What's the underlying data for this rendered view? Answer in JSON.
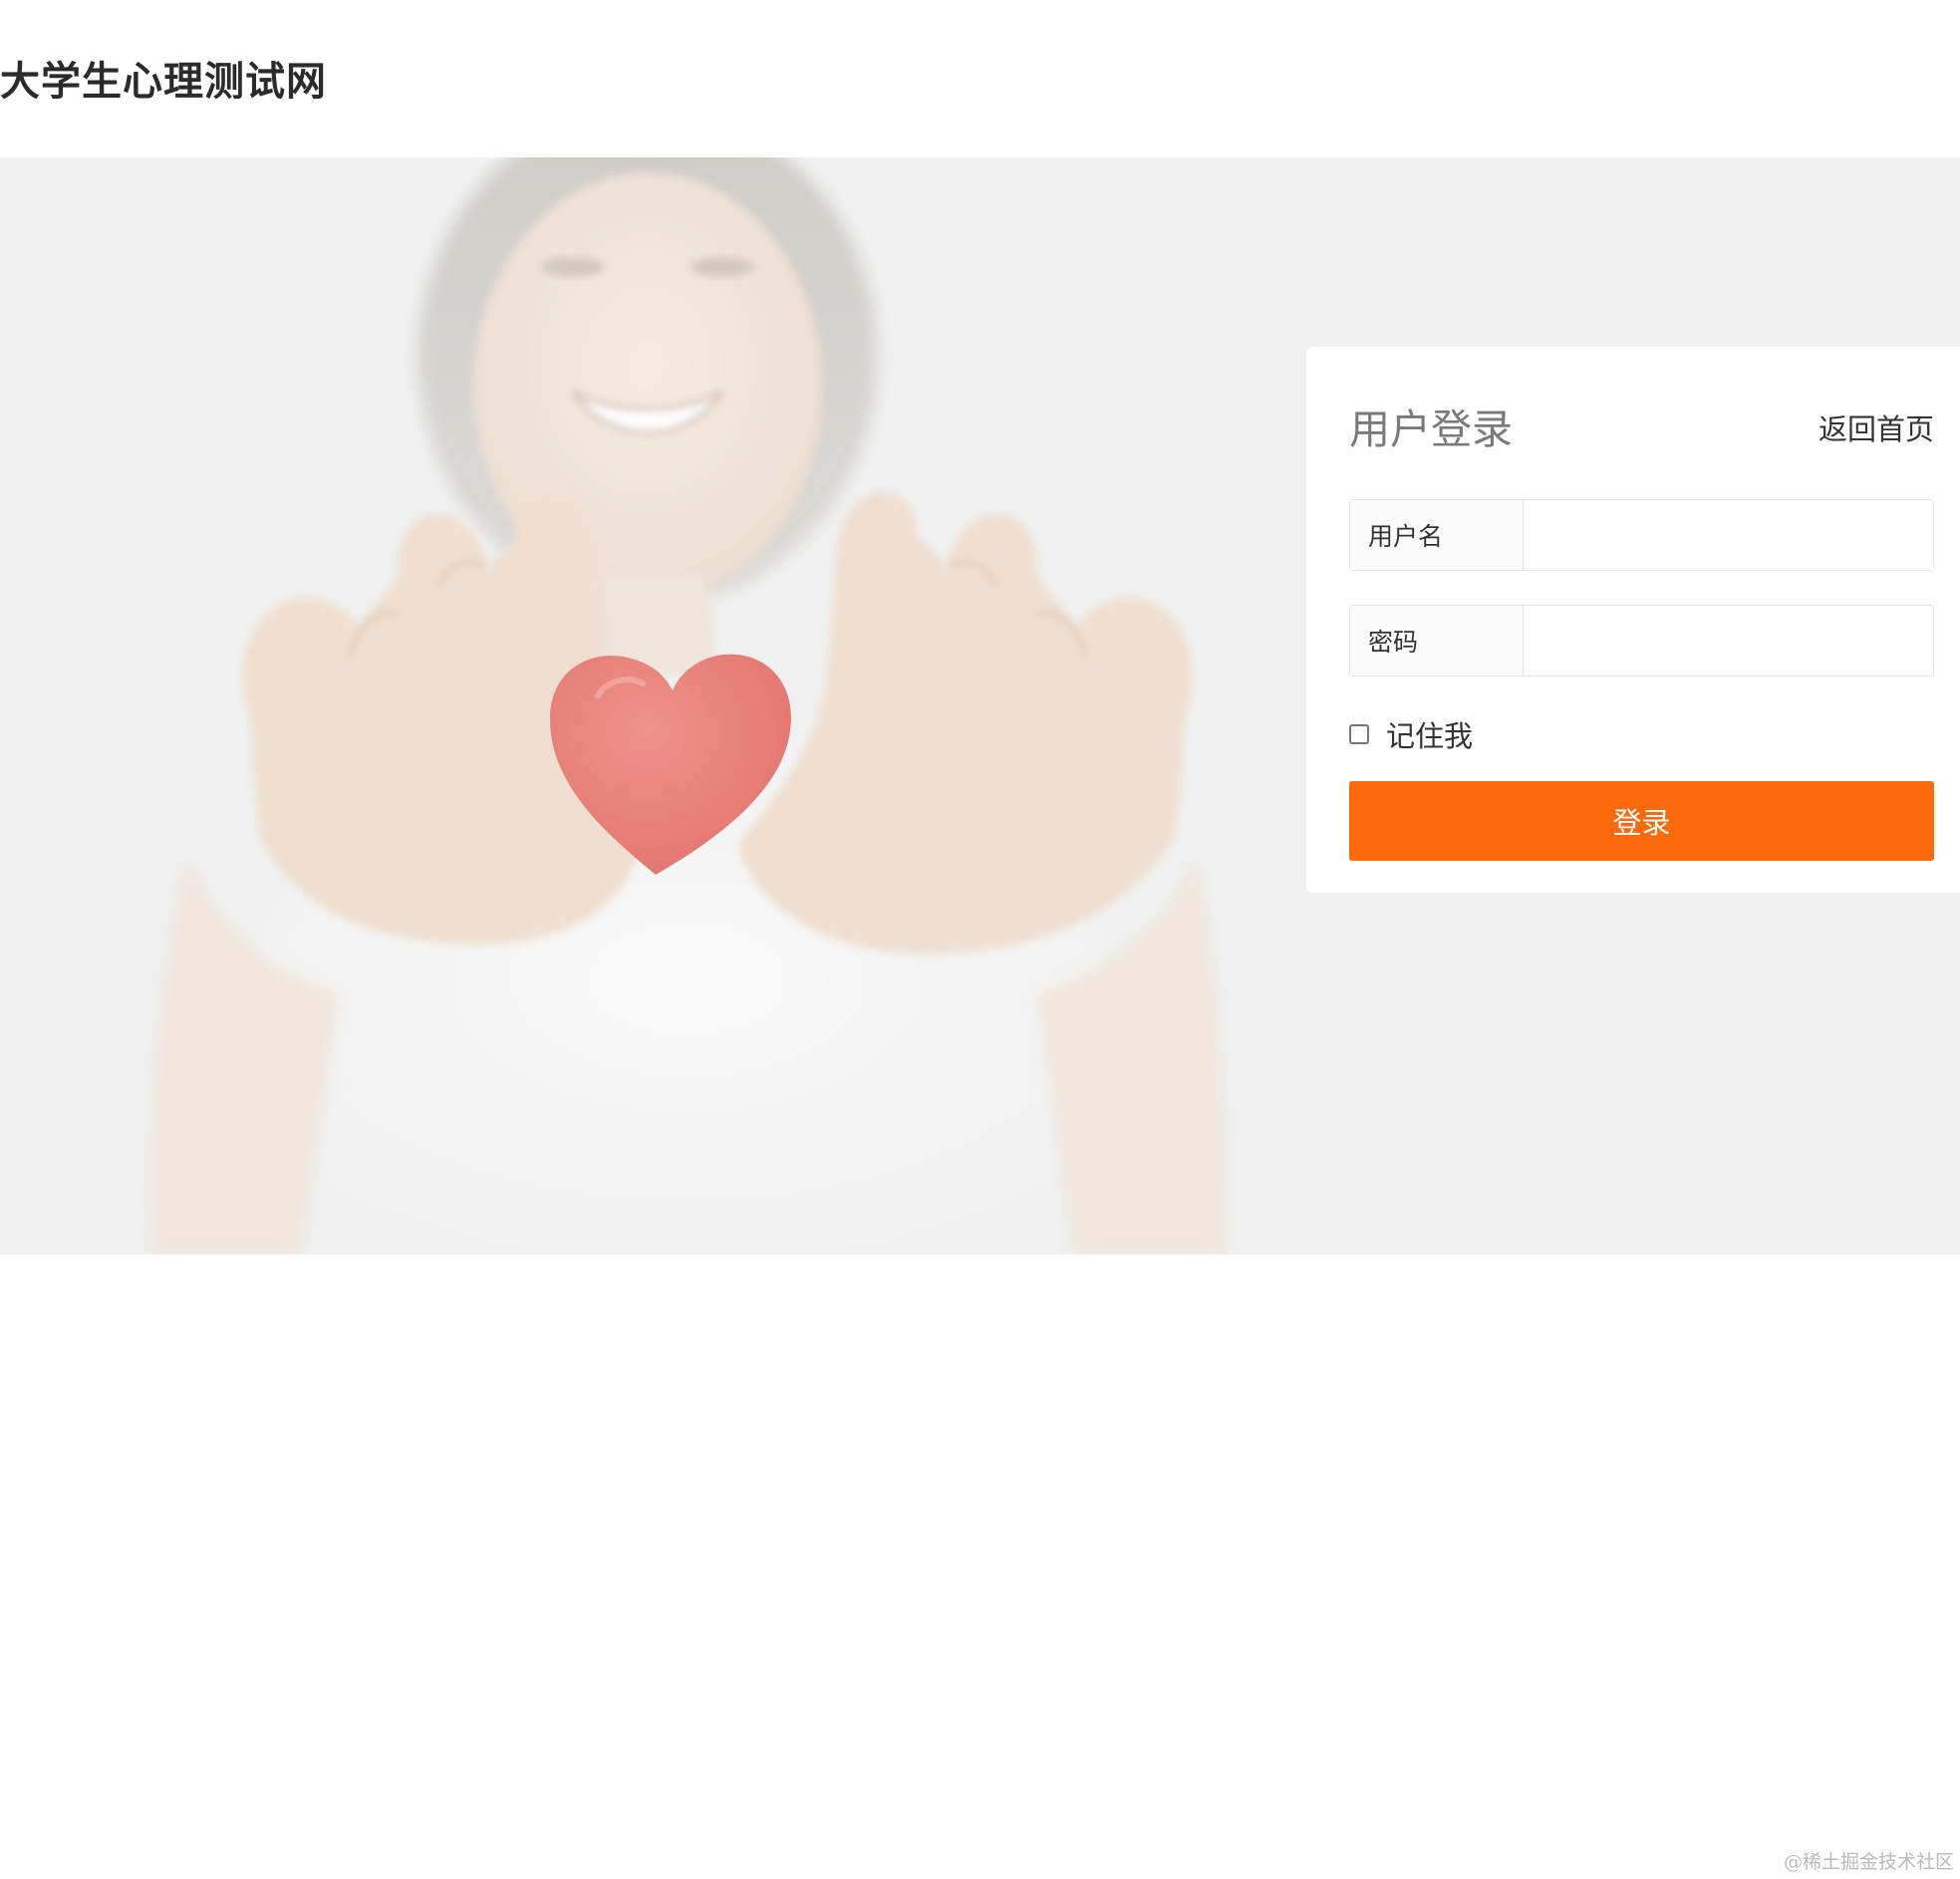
{
  "site": {
    "title": "大学生心理测试网"
  },
  "login": {
    "title": "用户登录",
    "back_link": "返回首页",
    "username_label": "用户名",
    "username_value": "",
    "password_label": "密码",
    "password_value": "",
    "remember_label": "记住我",
    "remember_checked": false,
    "submit_label": "登录"
  },
  "hero": {
    "image_subject": "woman holding red heart",
    "icon": "heart-icon"
  },
  "colors": {
    "accent": "#fb6a0d",
    "heart": "#e8625a",
    "hero_background": "#f0f1f0"
  },
  "watermark": "@稀土掘金技术社区"
}
